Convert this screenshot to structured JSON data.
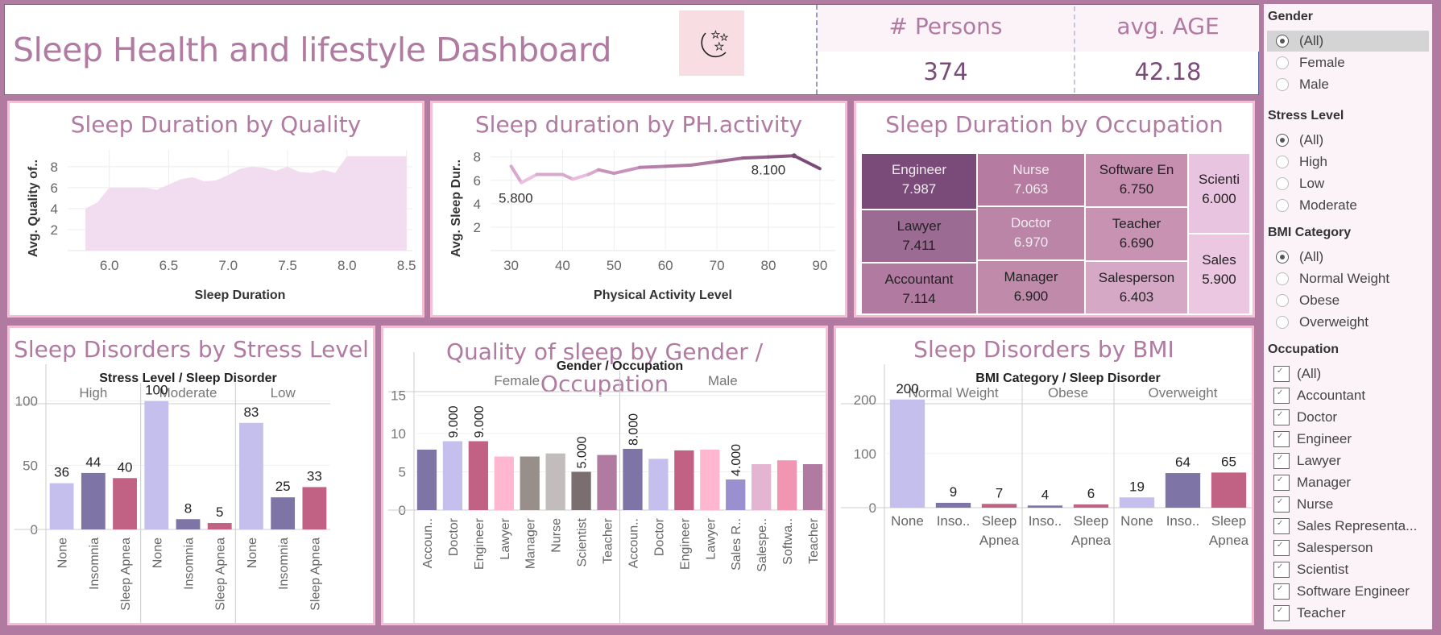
{
  "header": {
    "title": "Sleep Health and lifestyle Dashboard",
    "icon": "moon-stars-icon",
    "kpis": [
      {
        "label": "# Persons",
        "value": "374"
      },
      {
        "label": "avg. AGE",
        "value": "42.18"
      }
    ]
  },
  "colors": {
    "brand": "#b07aa1",
    "none": "#c5bfed",
    "insomnia": "#7e74a6",
    "sleep_apnea": "#c16284",
    "panel_border": "#f7bdd3"
  },
  "filters": {
    "gender": {
      "title": "Gender",
      "options": [
        "(All)",
        "Female",
        "Male"
      ],
      "selected": "(All)"
    },
    "stress": {
      "title": "Stress Level",
      "options": [
        "(All)",
        "High",
        "Low",
        "Moderate"
      ],
      "selected": "(All)"
    },
    "bmi": {
      "title": "BMI Category",
      "options": [
        "(All)",
        "Normal Weight",
        "Obese",
        "Overweight"
      ],
      "selected": "(All)"
    },
    "occupation": {
      "title": "Occupation",
      "options": [
        "(All)",
        "Accountant",
        "Doctor",
        "Engineer",
        "Lawyer",
        "Manager",
        "Nurse",
        "Sales Representa...",
        "Salesperson",
        "Scientist",
        "Software Engineer",
        "Teacher"
      ],
      "checked": [
        true,
        true,
        true,
        true,
        true,
        true,
        true,
        true,
        true,
        true,
        true,
        true
      ]
    }
  },
  "chart_data": [
    {
      "id": "quality",
      "type": "area",
      "title": "Sleep Duration by Quality",
      "xlabel": "Sleep Duration",
      "ylabel": "Avg. Quality of..",
      "x": [
        5.8,
        5.9,
        6.0,
        6.1,
        6.2,
        6.3,
        6.4,
        6.5,
        6.6,
        6.7,
        6.8,
        6.9,
        7.0,
        7.1,
        7.2,
        7.3,
        7.4,
        7.5,
        7.6,
        7.7,
        7.8,
        7.9,
        8.0,
        8.1,
        8.2,
        8.3,
        8.4,
        8.5
      ],
      "values": [
        4.0,
        4.6,
        6.0,
        6.0,
        6.0,
        6.0,
        5.8,
        6.3,
        6.8,
        7.0,
        6.6,
        6.7,
        7.2,
        7.8,
        8.0,
        7.9,
        7.6,
        8.0,
        7.5,
        7.4,
        7.7,
        7.4,
        9.0,
        9.0,
        9.0,
        9.0,
        9.0,
        9.0
      ],
      "xlim": [
        5.65,
        8.55
      ],
      "ylim": [
        0,
        9.6
      ],
      "xticks": [
        "6.0",
        "6.5",
        "7.0",
        "7.5",
        "8.0",
        "8.5"
      ],
      "yticks": [
        "2",
        "4",
        "6",
        "8"
      ],
      "grid": true
    },
    {
      "id": "activity",
      "type": "line",
      "title": "Sleep duration by PH.activity",
      "xlabel": "Physical Activity Level",
      "ylabel": "Avg. Sleep Dur..",
      "x": [
        30,
        32,
        35,
        40,
        42,
        45,
        47,
        50,
        55,
        60,
        65,
        70,
        75,
        80,
        85,
        90
      ],
      "values": [
        7.2,
        5.8,
        6.5,
        6.5,
        6.1,
        6.5,
        6.9,
        6.6,
        7.1,
        7.2,
        7.3,
        7.6,
        7.9,
        8.0,
        8.1,
        7.0
      ],
      "xlim": [
        26,
        93
      ],
      "ylim": [
        0,
        8.6
      ],
      "xticks": [
        "30",
        "40",
        "50",
        "60",
        "70",
        "80",
        "90"
      ],
      "yticks": [
        "2",
        "4",
        "6",
        "8"
      ],
      "annotations": [
        {
          "x": 32,
          "label": "5.800"
        },
        {
          "x": 85,
          "label": "8.100"
        }
      ],
      "grid": true
    },
    {
      "id": "occupation_treemap",
      "type": "treemap",
      "title": "Sleep Duration by Occupation",
      "items": [
        {
          "label": "Engineer",
          "value": "7.987",
          "color": "#7a4b78",
          "text": "#eee"
        },
        {
          "label": "Lawyer",
          "value": "7.411",
          "color": "#9c6b94",
          "text": "#222"
        },
        {
          "label": "Accountant",
          "value": "7.114",
          "color": "#b07aa1",
          "text": "#222"
        },
        {
          "label": "Nurse",
          "value": "7.063",
          "color": "#b57ba0",
          "text": "#eee"
        },
        {
          "label": "Doctor",
          "value": "6.970",
          "color": "#bb85a8",
          "text": "#eee"
        },
        {
          "label": "Manager",
          "value": "6.900",
          "color": "#c08aab",
          "text": "#222"
        },
        {
          "label": "Software En",
          "value": "6.750",
          "color": "#c68fb0",
          "text": "#222"
        },
        {
          "label": "Teacher",
          "value": "6.690",
          "color": "#c893b3",
          "text": "#222"
        },
        {
          "label": "Salesperson",
          "value": "6.403",
          "color": "#d5a8c6",
          "text": "#222"
        },
        {
          "label": "Scienti",
          "value": "6.000",
          "color": "#e9c4e0",
          "text": "#222"
        },
        {
          "label": "Sales",
          "value": "5.900",
          "color": "#ebc7e2",
          "text": "#222"
        }
      ]
    },
    {
      "id": "stress",
      "type": "bar",
      "title": "Sleep Disorders by Stress Level",
      "header": "Stress Level  /  Sleep Disorder",
      "groups": [
        {
          "name": "High",
          "bars": [
            {
              "label": "None",
              "value": 36
            },
            {
              "label": "Insomnia",
              "value": 44
            },
            {
              "label": "Sleep Apnea",
              "value": 40
            }
          ]
        },
        {
          "name": "Moderate",
          "bars": [
            {
              "label": "None",
              "value": 100
            },
            {
              "label": "Insomnia",
              "value": 8
            },
            {
              "label": "Sleep Apnea",
              "value": 5
            }
          ]
        },
        {
          "name": "Low",
          "bars": [
            {
              "label": "None",
              "value": 83
            },
            {
              "label": "Insomnia",
              "value": 25
            },
            {
              "label": "Sleep Apnea",
              "value": 33
            }
          ]
        }
      ],
      "ylim": [
        0,
        118
      ],
      "yticks": [
        "0",
        "50",
        "100"
      ]
    },
    {
      "id": "gender_occ",
      "type": "bar",
      "title": "Quality of sleep  by Gender / Occupation",
      "header": "Gender  /  Occupation",
      "groups": [
        {
          "name": "Female",
          "bars": [
            {
              "label": "Accoun..",
              "value": 7.9,
              "color": "#7e74a6"
            },
            {
              "label": "Doctor",
              "value": 9.0,
              "color": "#c5bfed",
              "show": "9.000"
            },
            {
              "label": "Engineer",
              "value": 9.0,
              "color": "#c16284",
              "show": "9.000"
            },
            {
              "label": "Lawyer",
              "value": 7.0,
              "color": "#ffb7cf"
            },
            {
              "label": "Manager",
              "value": 7.0,
              "color": "#988e8a"
            },
            {
              "label": "Nurse",
              "value": 7.4,
              "color": "#c2bcbd"
            },
            {
              "label": "Scientist",
              "value": 5.0,
              "color": "#7b6e6e",
              "show": "5.000"
            },
            {
              "label": "Teacher",
              "value": 7.2,
              "color": "#b07aa1"
            }
          ]
        },
        {
          "name": "Male",
          "bars": [
            {
              "label": "Accoun..",
              "value": 8.0,
              "color": "#7e74a6",
              "show": "8.000"
            },
            {
              "label": "Doctor",
              "value": 6.7,
              "color": "#c5bfed"
            },
            {
              "label": "Engineer",
              "value": 7.8,
              "color": "#c16284"
            },
            {
              "label": "Lawyer",
              "value": 7.9,
              "color": "#ffb7cf"
            },
            {
              "label": "Sales R..",
              "value": 4.0,
              "color": "#9a90cf",
              "show": "4.000"
            },
            {
              "label": "Salespe..",
              "value": 6.0,
              "color": "#e3b5d3"
            },
            {
              "label": "Softwa..",
              "value": 6.5,
              "color": "#f195b2"
            },
            {
              "label": "Teacher",
              "value": 6.0,
              "color": "#b07aa1"
            }
          ]
        }
      ],
      "ylim": [
        0,
        16
      ],
      "yticks": [
        "0",
        "5",
        "10",
        "15"
      ]
    },
    {
      "id": "bmi",
      "type": "bar",
      "title": "Sleep Disorders by BMI",
      "header": "BMI Category  /  Sleep Disorder",
      "groups": [
        {
          "name": "Normal Weight",
          "bars": [
            {
              "label": "None",
              "value": 200
            },
            {
              "label": "Inso..",
              "value": 9
            },
            {
              "label": "Sleep Apnea",
              "value": 7
            }
          ]
        },
        {
          "name": "Obese",
          "bars": [
            {
              "label": "Inso..",
              "value": 4
            },
            {
              "label": "Sleep Apnea",
              "value": 6
            }
          ]
        },
        {
          "name": "Overweight",
          "bars": [
            {
              "label": "None",
              "value": 19
            },
            {
              "label": "Inso..",
              "value": 64
            },
            {
              "label": "Sleep Apnea",
              "value": 65
            }
          ]
        }
      ],
      "ylim": [
        0,
        240
      ],
      "yticks": [
        "0",
        "100",
        "200"
      ]
    }
  ]
}
